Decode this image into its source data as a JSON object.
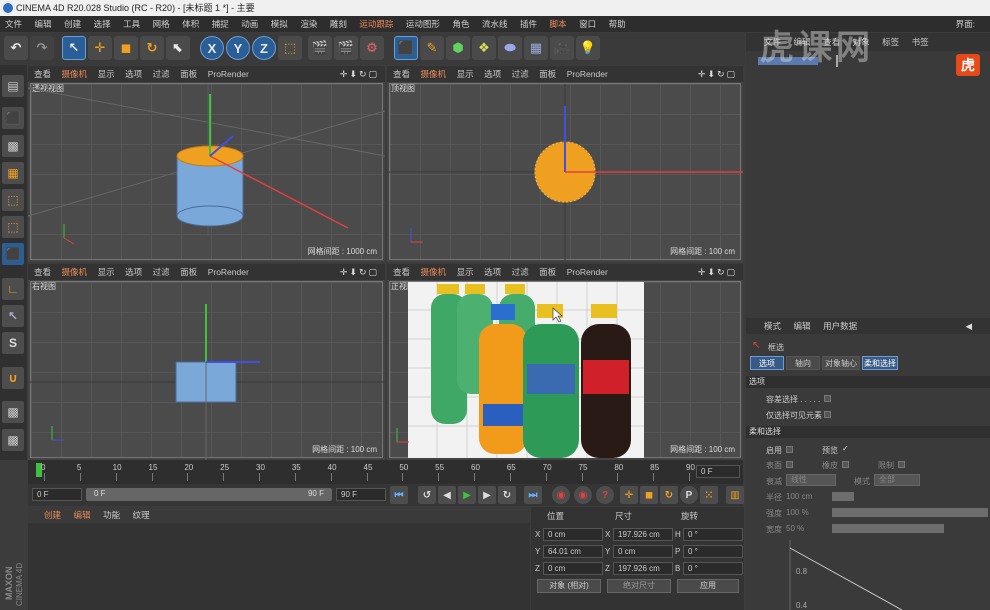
{
  "window": {
    "title": "CINEMA 4D R20.028 Studio (RC - R20) - [未标题 1 *] - 主要"
  },
  "menu": {
    "items": [
      "文件",
      "编辑",
      "创建",
      "选择",
      "工具",
      "网格",
      "体积",
      "捕捉",
      "动画",
      "模拟",
      "渲染",
      "雕刻",
      "运动跟踪",
      "运动图形",
      "角色",
      "流水线",
      "插件",
      "脚本",
      "窗口",
      "帮助"
    ],
    "layout_label": "界面:"
  },
  "toolbar": {
    "axis_x": "X",
    "axis_y": "Y",
    "axis_z": "Z"
  },
  "viewports": [
    {
      "name": "透视视图",
      "grid": "网格间距 : 1000 cm",
      "menu": [
        "查看",
        "摄像机",
        "显示",
        "选项",
        "过滤",
        "面板",
        "ProRender"
      ]
    },
    {
      "name": "顶视图",
      "grid": "网格间距 : 100 cm",
      "menu": [
        "查看",
        "摄像机",
        "显示",
        "选项",
        "过滤",
        "面板",
        "ProRender"
      ]
    },
    {
      "name": "右视图",
      "grid": "网格间距 : 100 cm",
      "menu": [
        "查看",
        "摄像机",
        "显示",
        "选项",
        "过滤",
        "面板",
        "ProRender"
      ]
    },
    {
      "name": "正视图",
      "grid": "网格间距 : 100 cm",
      "menu": [
        "查看",
        "摄像机",
        "显示",
        "选项",
        "过滤",
        "面板",
        "ProRender"
      ]
    }
  ],
  "timeline": {
    "ticks": [
      "0",
      "5",
      "10",
      "15",
      "20",
      "25",
      "30",
      "35",
      "40",
      "45",
      "50",
      "55",
      "60",
      "65",
      "70",
      "75",
      "80",
      "85",
      "90"
    ],
    "current": "0 F"
  },
  "transport": {
    "start": "0 F",
    "slider_left": "0 F",
    "slider_right": "90 F",
    "end": "90 F"
  },
  "material": {
    "menu": [
      "创建",
      "编辑",
      "功能",
      "纹理"
    ]
  },
  "coords": {
    "headers": [
      "位置",
      "尺寸",
      "旋转"
    ],
    "rows": [
      {
        "axis": "X",
        "pos": "0 cm",
        "saxis": "X",
        "size": "197.926 cm",
        "raxis": "H",
        "rot": "0 °"
      },
      {
        "axis": "Y",
        "pos": "64.01 cm",
        "saxis": "Y",
        "size": "0 cm",
        "raxis": "P",
        "rot": "0 °"
      },
      {
        "axis": "Z",
        "pos": "0 cm",
        "saxis": "Z",
        "size": "197.926 cm",
        "raxis": "B",
        "rot": "0 °"
      }
    ],
    "mode": "对象 (相对)",
    "size_mode": "绝对尺寸",
    "apply": "应用"
  },
  "object_manager": {
    "menu": [
      "文件",
      "编辑",
      "查看",
      "对象",
      "标签",
      "书签"
    ]
  },
  "watermark": "虎课网",
  "attributes": {
    "menu": [
      "模式",
      "编辑",
      "用户数据"
    ],
    "title": "框选",
    "tabs": [
      "选项",
      "轴向",
      "对象轴心",
      "柔和选择"
    ],
    "section_options": "选项",
    "opt1": "容差选择 . . . . .",
    "opt2": "仅选择可见元素",
    "section_soft": "柔和选择",
    "enable": "启用",
    "preview": "预览",
    "preview_mark": "✓",
    "surface": "表面",
    "rubber": "橡皮",
    "restrict": "限制",
    "falloff": "衰减",
    "falloff_val": "线性",
    "mode": "模式",
    "mode_val": "全部",
    "radius": "半径",
    "radius_val": "100 cm",
    "strength": "强度",
    "strength_val": "100 %",
    "width": "宽度",
    "width_val": "50 %",
    "graph_y1": "0.8",
    "graph_y2": "0.4"
  },
  "brand": {
    "top": "MAXON",
    "bottom": "CINEMA 4D"
  },
  "colors": {
    "accent": "#e98a58",
    "selection": "#2a5e96",
    "object": "#f0a020",
    "cylinder": "#7aa8d8"
  }
}
